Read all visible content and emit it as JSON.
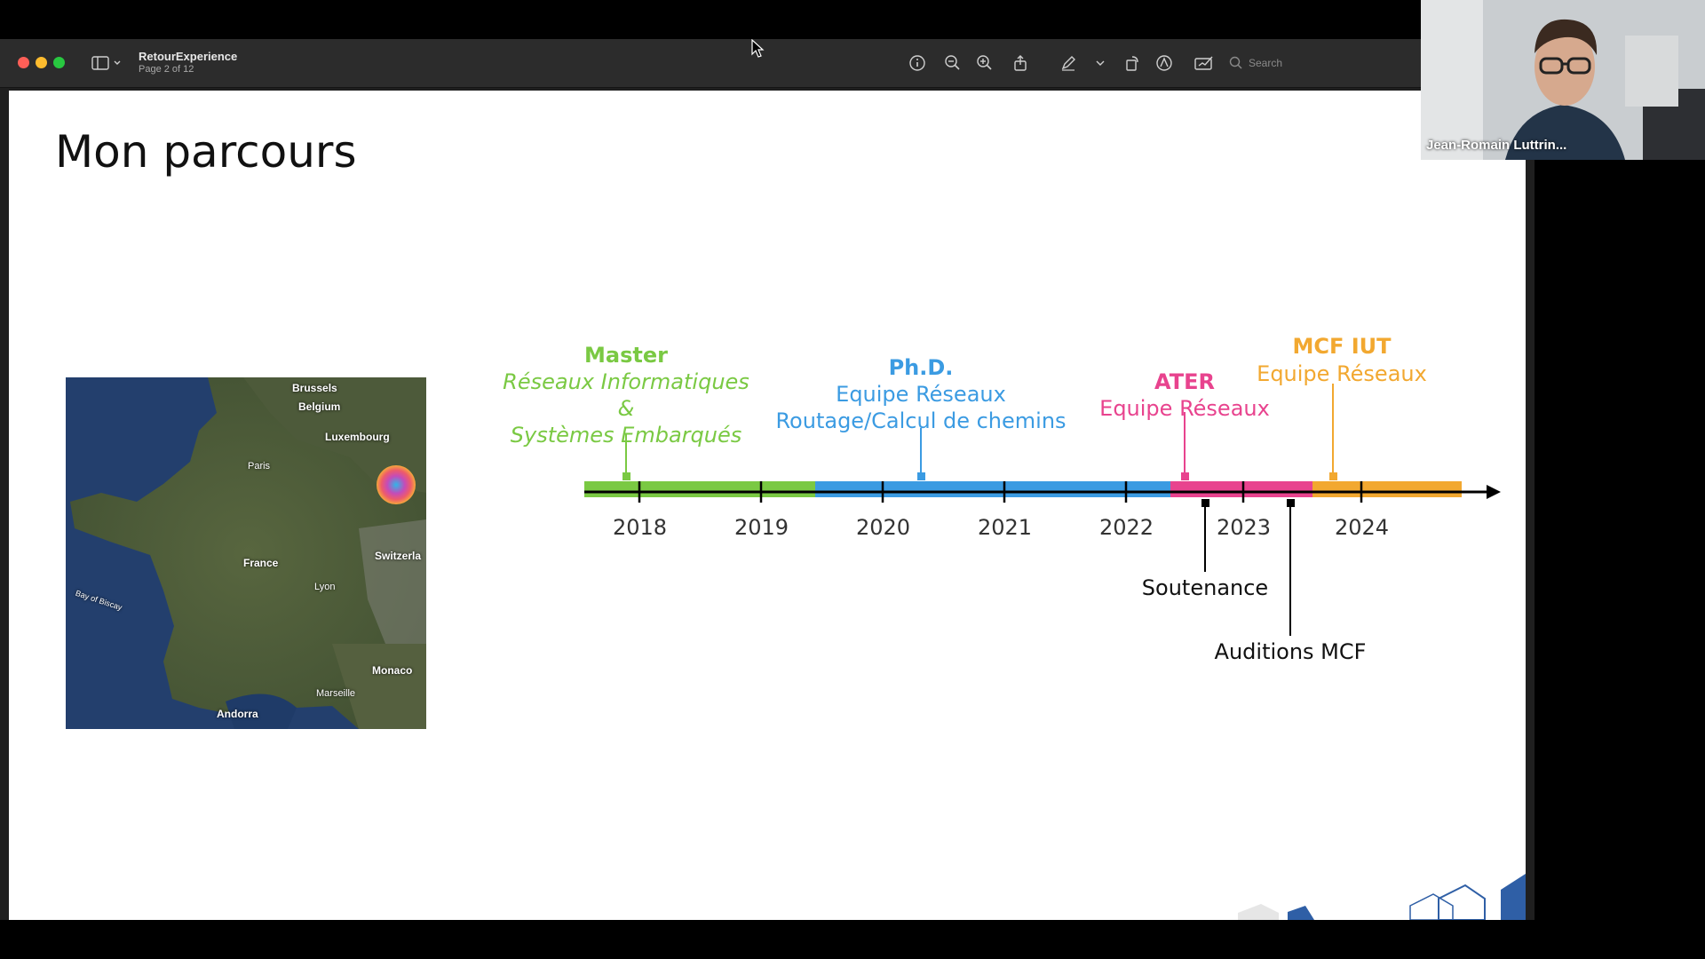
{
  "window": {
    "doc_title": "RetourExperience",
    "doc_subtitle": "Page 2 of 12",
    "search_placeholder": "Search"
  },
  "slide": {
    "title": "Mon parcours",
    "map_labels": {
      "brussels": "Brussels",
      "belgium": "Belgium",
      "luxembourg": "Luxembourg",
      "paris": "Paris",
      "france": "France",
      "switzerland": "Switzerla",
      "lyon": "Lyon",
      "bay_of_biscay": "Bay of Biscay",
      "monaco": "Monaco",
      "marseille": "Marseille",
      "andorra": "Andorra"
    },
    "timeline": {
      "years": [
        "2018",
        "2019",
        "2020",
        "2021",
        "2022",
        "2023",
        "2024"
      ],
      "master_title": "Master",
      "master_line1": "Réseaux Informatiques",
      "master_line2": "&",
      "master_line3": "Systèmes Embarqués",
      "phd_title": "Ph.D.",
      "phd_line1": "Equipe Réseaux",
      "phd_line2": "Routage/Calcul de chemins",
      "ater_title": "ATER",
      "ater_line1": "Equipe Réseaux",
      "mcf_title": "MCF IUT",
      "mcf_line1": "Equipe Réseaux",
      "soutenance": "Soutenance",
      "auditions": "Auditions MCF"
    },
    "colors": {
      "master": "#7ac943",
      "phd": "#3b9be2",
      "ater": "#e8438e",
      "mcf": "#f2a830"
    }
  },
  "participant": {
    "name": "Jean-Romain Luttrin..."
  }
}
